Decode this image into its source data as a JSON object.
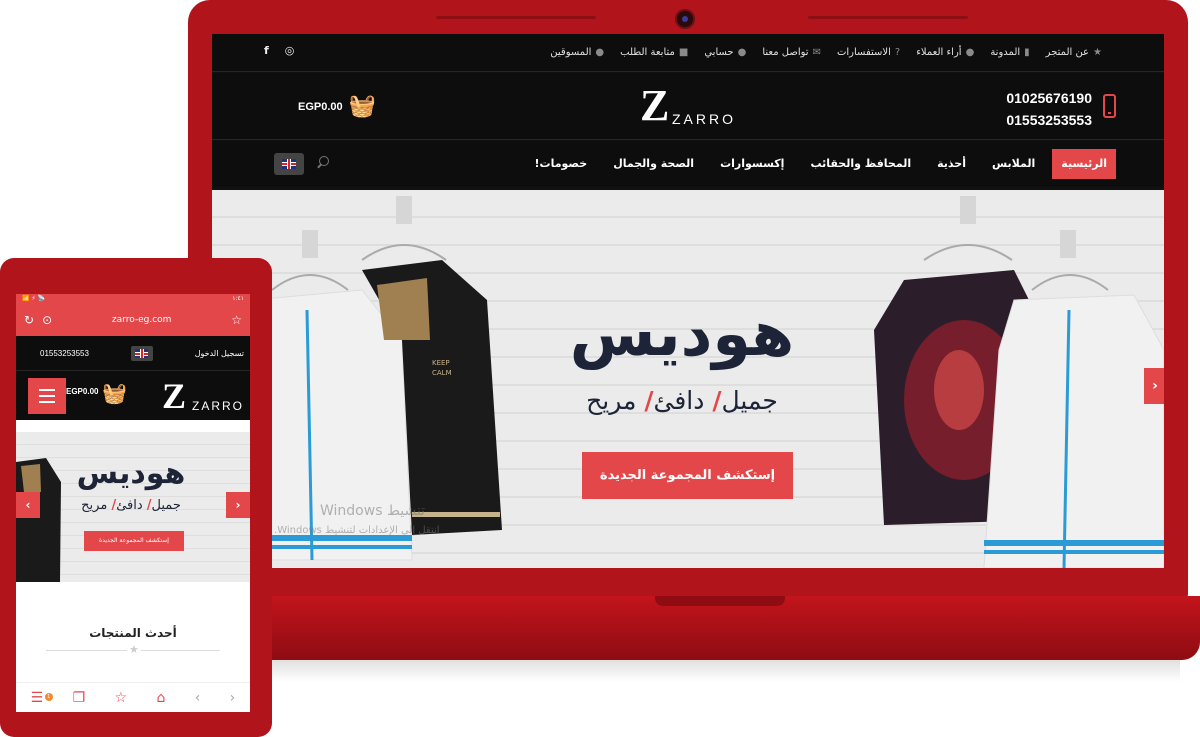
{
  "desktop": {
    "topbar": {
      "links": [
        {
          "label": "عن المتجر",
          "icon": "star-icon"
        },
        {
          "label": "المدونة",
          "icon": "document-icon"
        },
        {
          "label": "أراء العملاء",
          "icon": "chat-icon"
        },
        {
          "label": "الاستفسارات",
          "icon": "question-icon"
        },
        {
          "label": "تواصل معنا",
          "icon": "mail-icon"
        },
        {
          "label": "حسابي",
          "icon": "user-icon"
        },
        {
          "label": "متابعة الطلب",
          "icon": "truck-icon"
        },
        {
          "label": "المسوقين",
          "icon": "user-icon"
        }
      ],
      "social": [
        "instagram-icon",
        "facebook-icon"
      ]
    },
    "header": {
      "phone_1": "01025676190",
      "phone_2": "01553253553",
      "logo_mark": "Z",
      "logo_text": "ZARRO",
      "cart_total": "EGP0.00"
    },
    "nav": {
      "items": [
        "الرئيسية",
        "الملابس",
        "أحذية",
        "المحافظ والحقائب",
        "إكسسوارات",
        "الصحة والجمال",
        "خصومات!"
      ],
      "active_index": 0
    },
    "hero": {
      "title": "هوديس",
      "sub_1": "جميل",
      "sub_2": "دافئ",
      "sub_3": "مريح",
      "separator": "/",
      "cta": "إستكشف المجموعة الجديدة",
      "next_arrow": "›",
      "watermark_1": "Windows تنشيط",
      "watermark_2": "انتقل إلى الإعدادات لتنشيط Windows."
    }
  },
  "mobile": {
    "status_left": "📶 ⚡ 📡",
    "status_right": "١:٤١",
    "url": "zarro-eg.com",
    "phone": "01553253553",
    "login": "تسجيل الدخول",
    "cart_total": "EGP0.00",
    "logo_mark": "Z",
    "logo_text": "ZARRO",
    "hero": {
      "title": "هوديس",
      "sub_1": "جميل",
      "sub_2": "دافئ",
      "sub_3": "مريح",
      "separator": "/",
      "cta": "إستكشف المجموعة الجديدة"
    },
    "section_title": "أحدث المنتجات",
    "bottom_badge": "1"
  },
  "colors": {
    "device_red": "#b1141b",
    "accent": "#e4474a",
    "header_black": "#0d0d0d",
    "hero_text": "#1d2437"
  }
}
